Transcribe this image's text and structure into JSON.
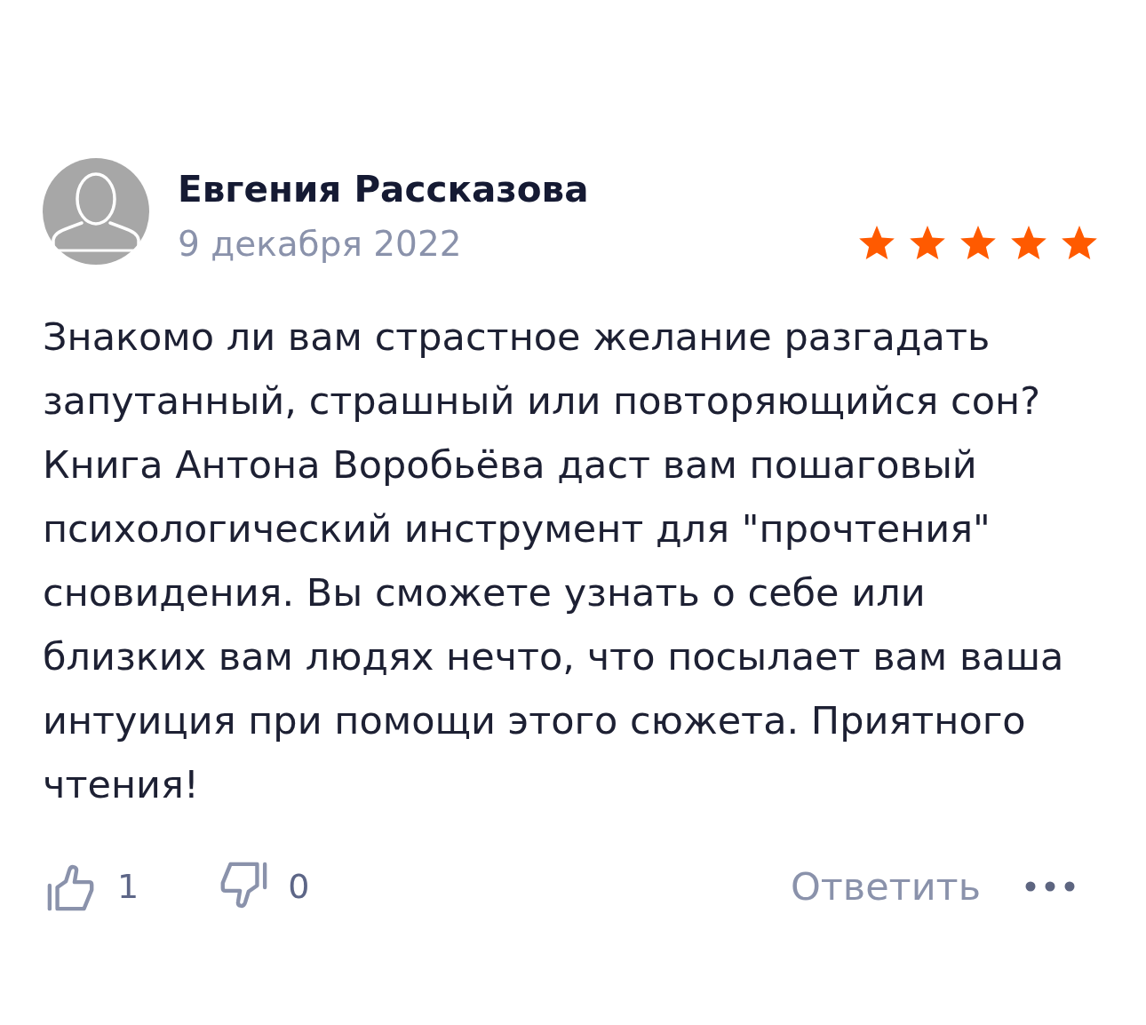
{
  "review": {
    "author": {
      "name": "Евгения Рассказова",
      "date": "9 декабря 2022"
    },
    "rating": {
      "stars": 5
    },
    "text": "Знакомо ли вам страстное желание разгадать запутанный, страшный или повторяющийся сон? Книга Антона Воробьёва даст вам пошаговый психологический инструмент для \"прочтения\" сновидения. Вы сможете узнать о себе или близких вам людях нечто, что посылает вам ваша интуиция при помощи этого сюжета. Приятного чтения!",
    "actions": {
      "likes": "1",
      "dislikes": "0",
      "reply": "Ответить"
    }
  }
}
